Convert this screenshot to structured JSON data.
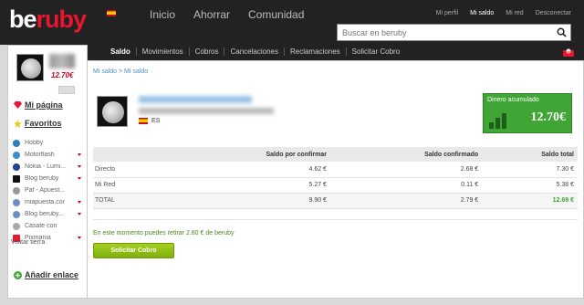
{
  "brand": {
    "logo_main": "be",
    "logo_accent": "ruby"
  },
  "main_nav": [
    "Inicio",
    "Ahorrar",
    "Comunidad"
  ],
  "user_nav": [
    "Mi perfil",
    "Mi saldo",
    "Mi red",
    "Desconectar"
  ],
  "search": {
    "placeholder": "Buscar en beruby"
  },
  "sub_nav": [
    "Saldo",
    "Movimientos",
    "Cobros",
    "Cancelaciones",
    "Reclamaciones",
    "Solicitar Cobro"
  ],
  "sidebar": {
    "balance": "12.70€",
    "links": {
      "my_page": "Mi página",
      "favorites": "Favoritos",
      "add_link": "Añadir enlace"
    },
    "favorites": [
      {
        "label": "Hobby",
        "color": "#2a7fc1",
        "arrow": false
      },
      {
        "label": "Motorflash",
        "color": "#3a8fd1",
        "arrow": true
      },
      {
        "label": "Nokia - Lumi...",
        "color": "#224488",
        "arrow": true
      },
      {
        "label": "Blog beruby",
        "color": "#111111",
        "arrow": true
      },
      {
        "label": "Paf - Apuest...",
        "color": "#999999",
        "arrow": false
      },
      {
        "label": "miapuesta.cor",
        "color": "#6a8fc7",
        "arrow": true
      },
      {
        "label": "Blog beruby...",
        "color": "#6a8fc7",
        "arrow": true
      },
      {
        "label": "Cásate con",
        "color": "#aaaaaa",
        "arrow": false
      },
      {
        "label": "Pixmania",
        "color": "#e8162f",
        "arrow": true
      }
    ],
    "visitar": "Visitar tierra"
  },
  "main": {
    "breadcrumb": "Mi saldo > Mi saldo",
    "country": "ES",
    "accumulated": {
      "title": "Dinero acumulado",
      "value": "12.70€"
    },
    "table": {
      "headers": [
        "",
        "Saldo por confirmar",
        "Saldo confirmado",
        "Saldo total"
      ],
      "rows": [
        {
          "label": "Directo",
          "pending": "4.62 €",
          "confirmed": "2.68 €",
          "total": "7.30 €"
        },
        {
          "label": "Mi Red",
          "pending": "5.27 €",
          "confirmed": "0.11 €",
          "total": "5.38 €"
        },
        {
          "label": "TOTAL",
          "pending": "9.90 €",
          "confirmed": "2.79 €",
          "total": "12.69 €"
        }
      ]
    },
    "withdraw_message": "En este momento puedes retirar 2.80 € de beruby",
    "withdraw_button": "Solicitar Cobro"
  },
  "colors": {
    "accent_green": "#3fa535",
    "brand_red": "#e8162f",
    "topbar": "#222222"
  }
}
